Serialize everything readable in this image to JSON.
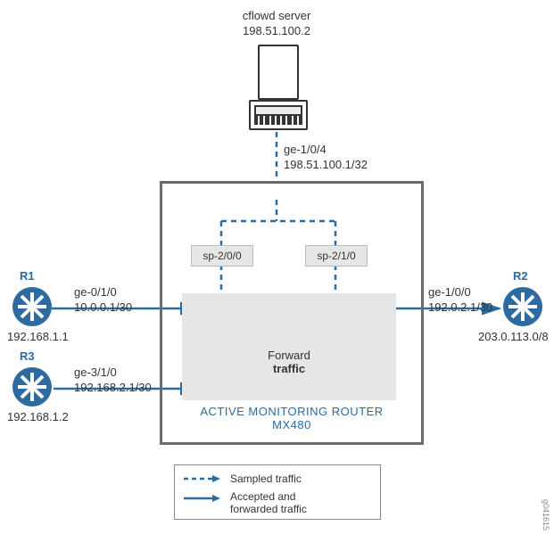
{
  "server": {
    "title": "cflowd server",
    "ip": "198.51.100.2"
  },
  "uplink": {
    "if": "ge-1/0/4",
    "ip": "198.51.100.1/32"
  },
  "sp": {
    "a": "sp-2/0/0",
    "b": "sp-2/1/0"
  },
  "forward": {
    "l1": "Forward",
    "l2": "traffic"
  },
  "router_box": {
    "l1": "ACTIVE MONITORING ROUTER",
    "l2": "MX480"
  },
  "r1": {
    "name": "R1",
    "if": "ge-0/1/0",
    "ifip": "10.0.0.1/30",
    "ip": "192.168.1.1"
  },
  "r3": {
    "name": "R3",
    "if": "ge-3/1/0",
    "ifip": "192.168.2.1/30",
    "ip": "192.168.1.2"
  },
  "r2": {
    "name": "R2",
    "if": "ge-1/0/0",
    "ifip": "192.0.2.1/30",
    "ip": "203.0.113.0/8"
  },
  "legend": {
    "sampled": "Sampled traffic",
    "accepted": "Accepted and\nforwarded traffic"
  },
  "figno": "g041615"
}
